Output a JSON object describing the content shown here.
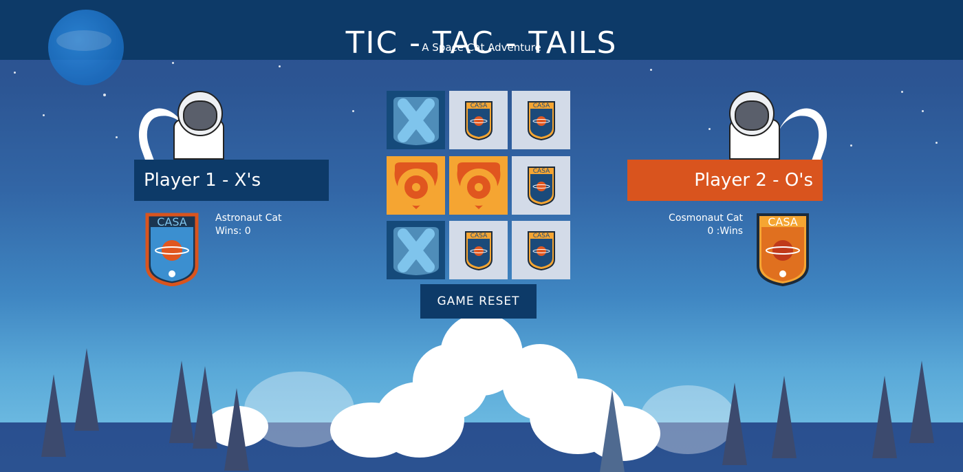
{
  "header": {
    "title": "TIC - TAC - TAILS",
    "subtitle": "A Space Cat Adventure"
  },
  "player1": {
    "label": "Player 1 - X's",
    "name": "Astronaut Cat",
    "wins_text": "Wins: 0",
    "badge_text": "CASA",
    "color": "#0d3a68"
  },
  "player2": {
    "label": "Player 2 - O's",
    "name": "Cosmonaut Cat",
    "wins_text": "0 :Wins",
    "badge_text": "CASA",
    "color": "#d9541e"
  },
  "board": {
    "cells": [
      "X",
      "",
      "",
      "O",
      "O",
      "",
      "X",
      "",
      ""
    ],
    "empty_badge_text": "CASA"
  },
  "controls": {
    "reset_label": "GAME RESET"
  },
  "colors": {
    "x_tile": "#154a7a",
    "x_mark": "#7fc4ec",
    "o_tile": "#f5a532",
    "o_mark": "#e0561f",
    "empty_tile": "#d3dbe8"
  }
}
